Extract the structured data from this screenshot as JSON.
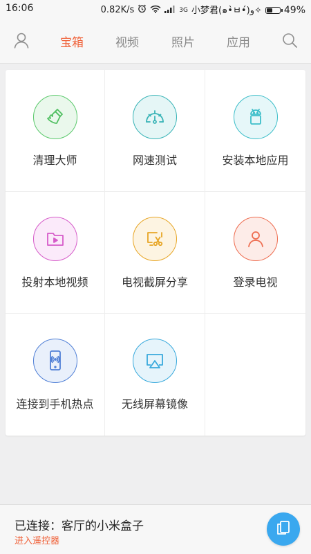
{
  "status_bar": {
    "time": "16:06",
    "speed": "0.82K/s",
    "network": "3G",
    "carrier": "小梦君(๑•̀ㅂ•́)و✧",
    "battery": "49%",
    "battery_level": 0.49
  },
  "nav": {
    "tabs": [
      {
        "label": "宝箱",
        "active": true
      },
      {
        "label": "视频",
        "active": false
      },
      {
        "label": "照片",
        "active": false
      },
      {
        "label": "应用",
        "active": false
      }
    ],
    "user_icon": "user-icon",
    "search_icon": "search-icon"
  },
  "grid": {
    "items": [
      {
        "label": "清理大师",
        "icon": "broom-icon",
        "color": "#5ac96b",
        "bg": "#eaf8ec"
      },
      {
        "label": "网速测试",
        "icon": "speedometer-icon",
        "color": "#37b3b6",
        "bg": "#e5f6f6"
      },
      {
        "label": "安装本地应用",
        "icon": "android-icon",
        "color": "#3dbec9",
        "bg": "#e6f7f9"
      },
      {
        "label": "投射本地视频",
        "icon": "video-folder-icon",
        "color": "#d65bc9",
        "bg": "#fbeafa"
      },
      {
        "label": "电视截屏分享",
        "icon": "tv-screenshot-icon",
        "color": "#e7a524",
        "bg": "#fdf4e2"
      },
      {
        "label": "登录电视",
        "icon": "user-login-icon",
        "color": "#ee6c4f",
        "bg": "#fdece8"
      },
      {
        "label": "连接到手机热点",
        "icon": "phone-hotspot-icon",
        "color": "#4f7fd6",
        "bg": "#e9f0fb"
      },
      {
        "label": "无线屏幕镜像",
        "icon": "screen-mirror-icon",
        "color": "#38a9dc",
        "bg": "#e6f4fb"
      }
    ]
  },
  "bottom_bar": {
    "connected": "已连接：客厅的小米盒子",
    "remote_link": "进入遥控器",
    "fab_icon": "remote-screens-icon"
  },
  "colors": {
    "accent": "#f0633b",
    "fab": "#3aa8ef"
  }
}
